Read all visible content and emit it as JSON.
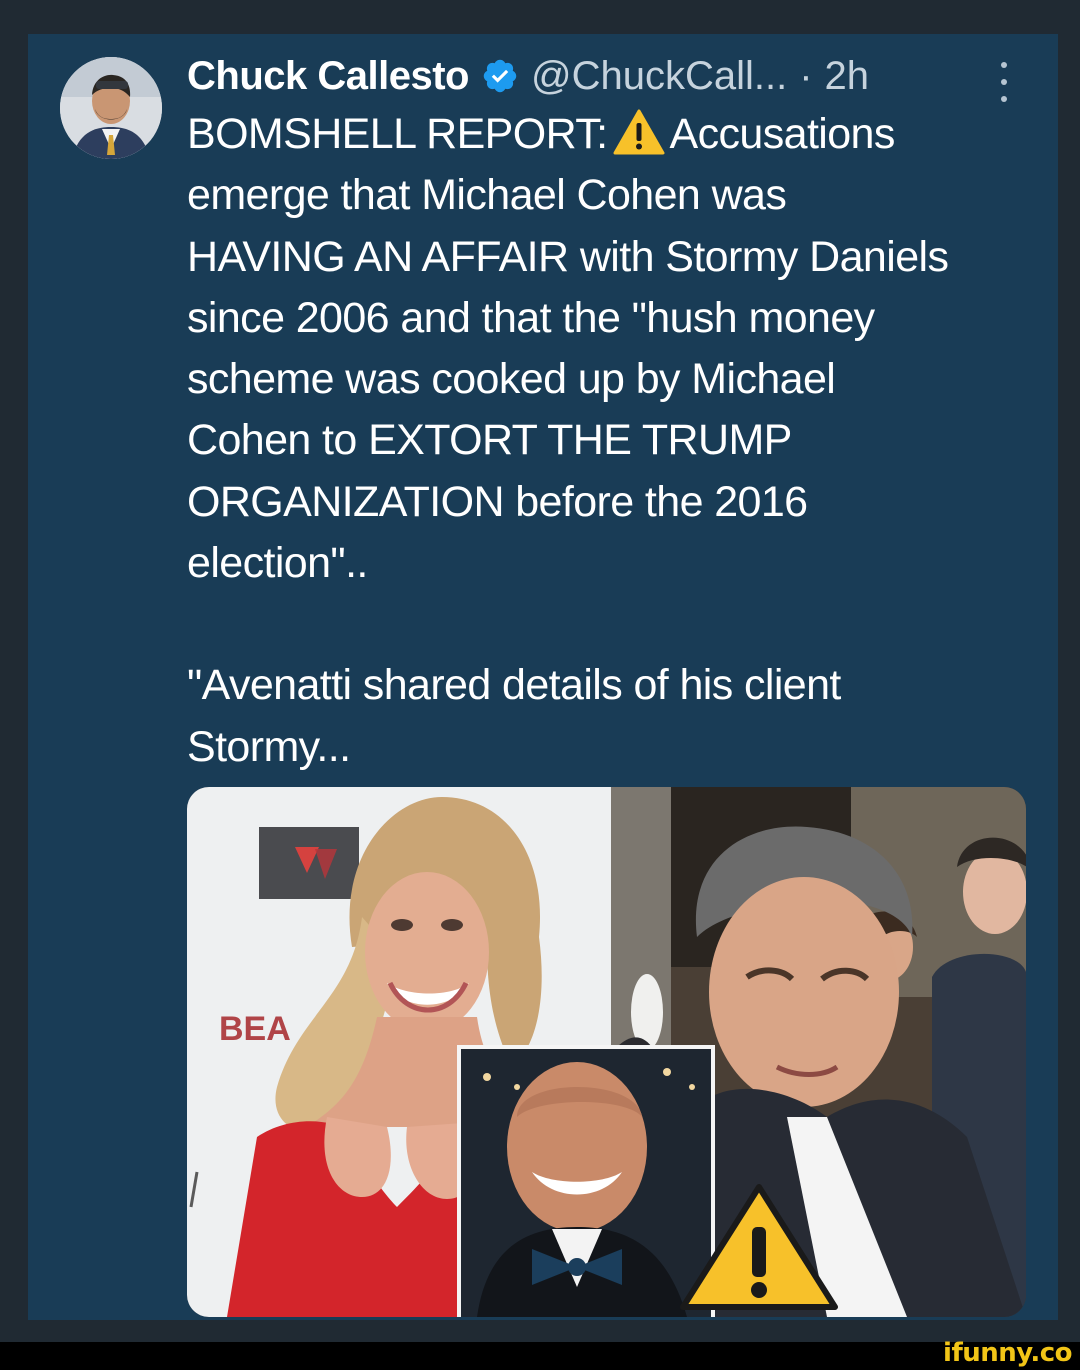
{
  "tweet": {
    "author": {
      "display_name": "Chuck Callesto",
      "verified": true,
      "handle": "@ChuckCall...",
      "separator": "·",
      "time": "2h"
    },
    "text_lines": [
      "BOMSHELL REPORT:",
      "Accusations",
      "emerge that Michael Cohen was",
      "HAVING AN AFFAIR with Stormy Daniels",
      "since 2006 and that the \"hush money",
      "scheme was cooked up by Michael",
      "Cohen to EXTORT THE TRUMP",
      "ORGANIZATION before the 2016",
      "election\".."
    ],
    "text_lines_2": [
      "\"Avenatti shared details of his client",
      "Stormy..."
    ],
    "media": {
      "sign_text": "BEA"
    }
  },
  "watermark": "ifunny.co",
  "colors": {
    "card_bg": "#193c56",
    "verified": "#1d9bf0",
    "warning": "#f7c12a",
    "watermark": "#f2c517"
  },
  "icons": [
    "verified-badge-icon",
    "warning-icon",
    "more-options-icon"
  ]
}
